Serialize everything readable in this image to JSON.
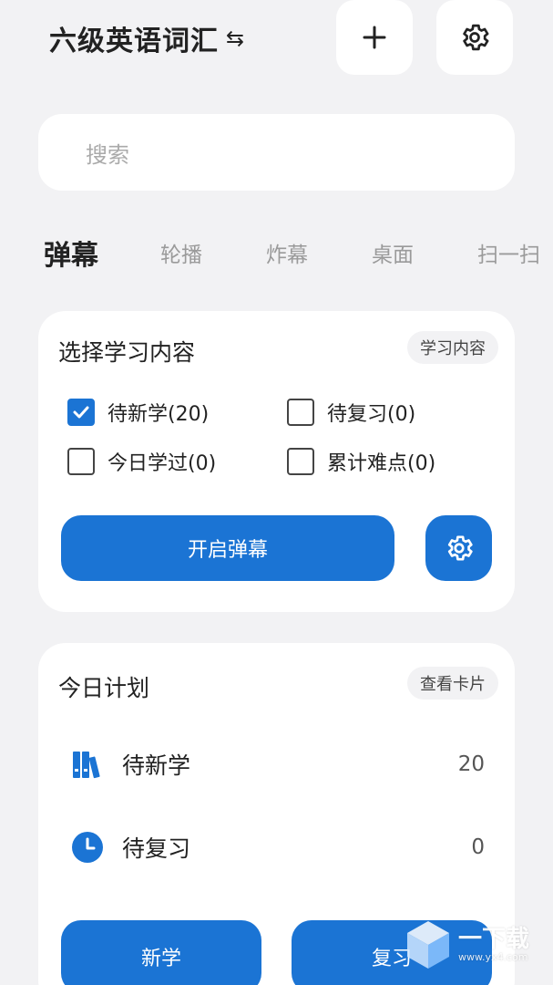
{
  "header": {
    "title": "六级英语词汇",
    "swap_icon_glyph": "⇆",
    "add_icon": "plus-icon",
    "settings_icon": "gear-icon"
  },
  "search": {
    "placeholder": "搜索"
  },
  "tabs": [
    {
      "label": "弹幕",
      "active": true
    },
    {
      "label": "轮播",
      "active": false
    },
    {
      "label": "炸幕",
      "active": false
    },
    {
      "label": "桌面",
      "active": false
    },
    {
      "label": "扫一扫",
      "active": false
    }
  ],
  "select_card": {
    "title": "选择学习内容",
    "chip": "学习内容",
    "options": [
      {
        "label": "待新学(20)",
        "checked": true
      },
      {
        "label": "待复习(0)",
        "checked": false
      },
      {
        "label": "今日学过(0)",
        "checked": false
      },
      {
        "label": "累计难点(0)",
        "checked": false
      }
    ],
    "start_button": "开启弹幕"
  },
  "plan_card": {
    "title": "今日计划",
    "chip": "查看卡片",
    "rows": [
      {
        "label": "待新学",
        "value": "20",
        "icon": "books-icon"
      },
      {
        "label": "待复习",
        "value": "0",
        "icon": "clock-icon"
      }
    ],
    "learn_button": "新学",
    "review_button": "复习"
  },
  "watermark": {
    "text": "一下载",
    "sub": "www.yx4.com"
  },
  "colors": {
    "accent": "#1b74d4",
    "background": "#f2f2f4",
    "card": "#ffffff"
  }
}
